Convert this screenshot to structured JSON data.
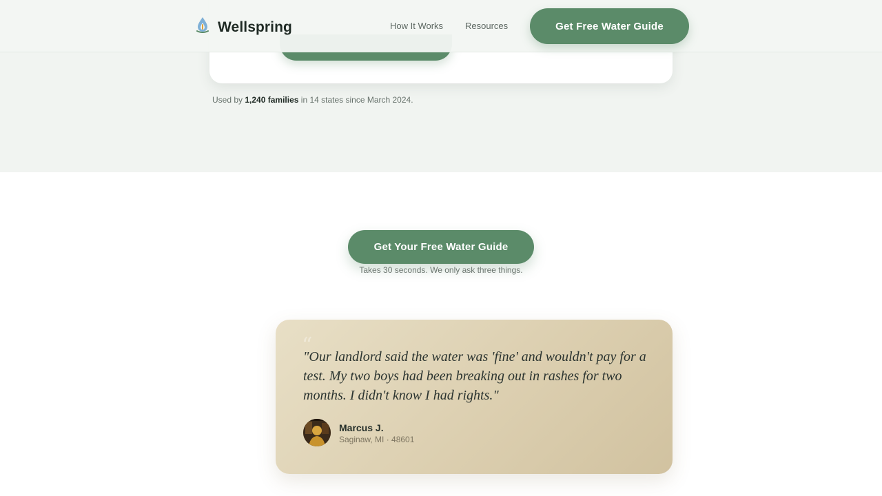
{
  "header": {
    "brand": "Wellspring",
    "nav": [
      {
        "label": "How It Works"
      },
      {
        "label": "Resources"
      }
    ],
    "cta_label": "Get Free Water Guide"
  },
  "hero": {
    "social_proof_prefix": "Used by",
    "social_proof_highlight": "1,240 families",
    "social_proof_suffix": "in 14 states since March 2024."
  },
  "cta_section": {
    "button_label": "Get Your Free Water Guide",
    "note": "Takes 30 seconds. We only ask three things."
  },
  "testimonial": {
    "quote": "\"Our landlord said the water was 'fine' and wouldn't pay for a test. My two boys had been breaking out in rashes for two months. I didn't know I had rights.\"",
    "author_name": "Marcus J.",
    "author_location": "Saginaw, MI · 48601",
    "avatar_icon": "person-photo"
  },
  "colors": {
    "accent": "#5b8b69",
    "hero_bg": "#f1f4f1",
    "testimonial_bg": "#dccfb0"
  }
}
